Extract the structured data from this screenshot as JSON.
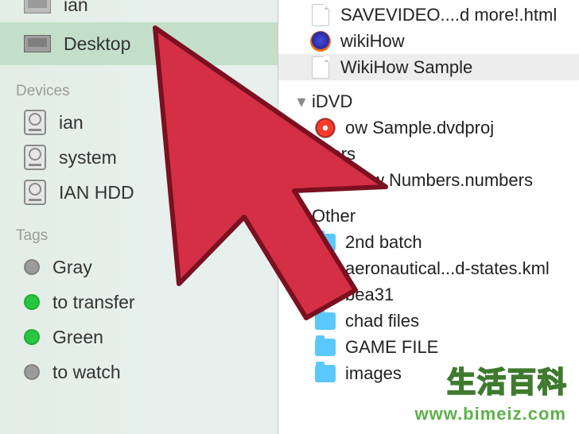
{
  "sidebar": {
    "favorites": {
      "items": [
        {
          "label": "ian",
          "icon": "desktop"
        },
        {
          "label": "Desktop",
          "icon": "desktop",
          "selected": true
        }
      ]
    },
    "devices": {
      "heading": "Devices",
      "items": [
        {
          "label": "ian",
          "icon": "hdd"
        },
        {
          "label": "system",
          "icon": "hdd"
        },
        {
          "label": "IAN HDD",
          "icon": "hdd"
        }
      ]
    },
    "tags": {
      "heading": "Tags",
      "items": [
        {
          "label": "Gray",
          "color": "#9b9b9b"
        },
        {
          "label": "to transfer",
          "color": "#27c840"
        },
        {
          "label": "Green",
          "color": "#27c840"
        },
        {
          "label": "to watch",
          "color": "#9b9b9b"
        }
      ]
    }
  },
  "files": {
    "top": [
      {
        "label": "SAVEVIDEO....d more!.html",
        "icon": "doc",
        "indent": true
      },
      {
        "label": "wikiHow",
        "icon": "firefox",
        "indent": true
      },
      {
        "label": "WikiHow Sample",
        "icon": "doc",
        "indent": true,
        "selected": true
      }
    ],
    "groups": [
      {
        "header": "iDVD",
        "items": [
          {
            "label": "ow Sample.dvdproj",
            "icon": "idvd"
          }
        ]
      },
      {
        "header": "nbers",
        "items": [
          {
            "label": "iHow Numbers.numbers",
            "icon": "numbers"
          }
        ]
      },
      {
        "header": "Other",
        "items": [
          {
            "label": "2nd batch",
            "icon": "folder"
          },
          {
            "label": "aeronautical...d-states.kml",
            "icon": "doc"
          },
          {
            "label": "bea31",
            "icon": "folder"
          },
          {
            "label": "chad files",
            "icon": "folder"
          },
          {
            "label": "GAME FILE",
            "icon": "folder"
          },
          {
            "label": "images",
            "icon": "folder"
          }
        ]
      }
    ]
  },
  "watermark": {
    "cn": "生活百科",
    "url": "www.bimeiz.com"
  }
}
